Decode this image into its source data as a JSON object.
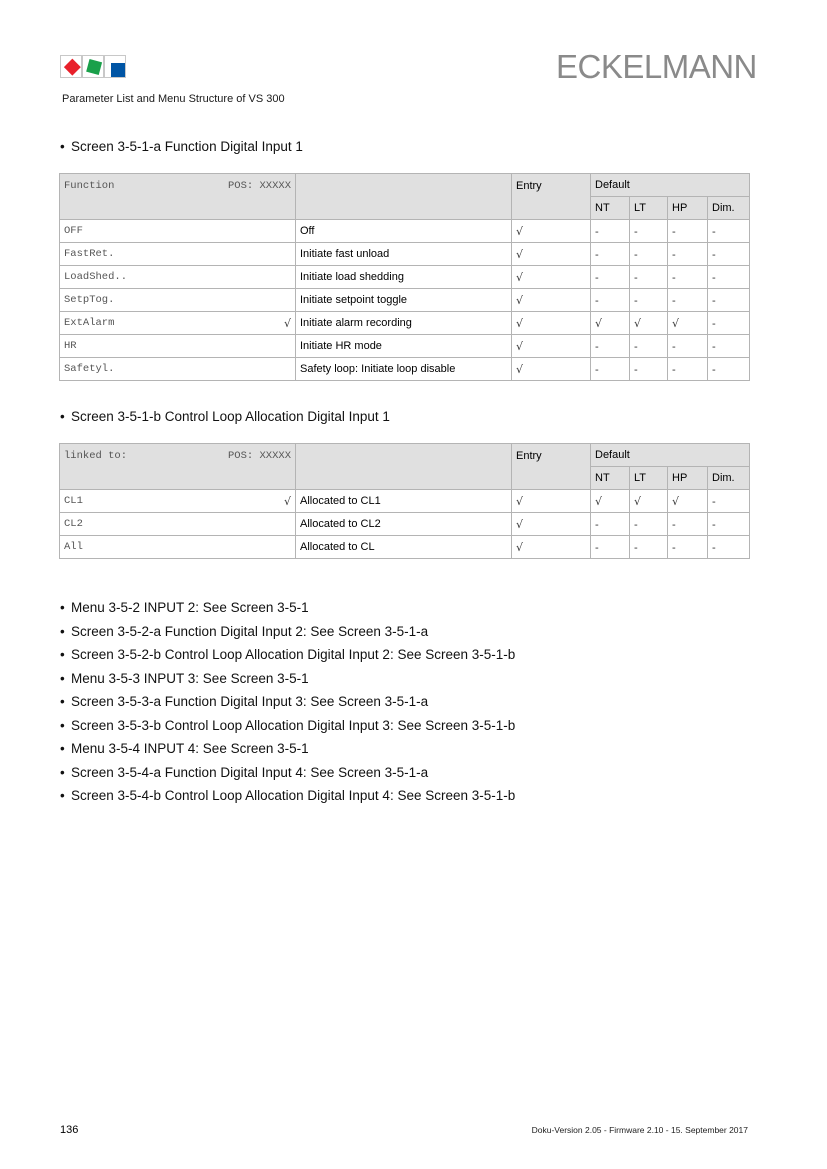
{
  "header": {
    "brand": "ECKELMANN",
    "subtitle": "Parameter List and Menu Structure of VS 300",
    "logo_colors": [
      "#e8202a",
      "#1aa04a",
      "#0055a5"
    ]
  },
  "bullet": "•",
  "check": "√",
  "sections": [
    {
      "heading": "Screen 3-5-1-a Function Digital Input 1",
      "table": {
        "header": {
          "param": "Function",
          "pos": "POS: XXXXX",
          "entry": "Entry",
          "default": "Default",
          "subcols": [
            "NT",
            "LT",
            "HP",
            "Dim."
          ]
        },
        "rows": [
          {
            "param": "OFF",
            "mark": "",
            "desc": "Off",
            "entry": "√",
            "nt": "-",
            "lt": "-",
            "hp": "-",
            "dim": "-"
          },
          {
            "param": "FastRet.",
            "mark": "",
            "desc": "Initiate fast unload",
            "entry": "√",
            "nt": "-",
            "lt": "-",
            "hp": "-",
            "dim": "-"
          },
          {
            "param": "LoadShed..",
            "mark": "",
            "desc": "Initiate load shedding",
            "entry": "√",
            "nt": "-",
            "lt": "-",
            "hp": "-",
            "dim": "-"
          },
          {
            "param": "SetpTog.",
            "mark": "",
            "desc": "Initiate setpoint toggle",
            "entry": "√",
            "nt": "-",
            "lt": "-",
            "hp": "-",
            "dim": "-"
          },
          {
            "param": "ExtAlarm",
            "mark": "√",
            "desc": "Initiate alarm recording",
            "entry": "√",
            "nt": "√",
            "lt": "√",
            "hp": "√",
            "dim": "-"
          },
          {
            "param": "HR",
            "mark": "",
            "desc": "Initiate HR mode",
            "entry": "√",
            "nt": "-",
            "lt": "-",
            "hp": "-",
            "dim": "-"
          },
          {
            "param": "Safetyl.",
            "mark": "",
            "desc": "Safety loop: Initiate loop disable",
            "entry": "√",
            "nt": "-",
            "lt": "-",
            "hp": "-",
            "dim": "-"
          }
        ]
      }
    },
    {
      "heading": "Screen 3-5-1-b Control Loop Allocation Digital Input 1",
      "table": {
        "header": {
          "param": "linked to:",
          "pos": "POS: XXXXX",
          "entry": "Entry",
          "default": "Default",
          "subcols": [
            "NT",
            "LT",
            "HP",
            "Dim."
          ]
        },
        "rows": [
          {
            "param": "CL1",
            "mark": "√",
            "desc": "Allocated to CL1",
            "entry": "√",
            "nt": "√",
            "lt": "√",
            "hp": "√",
            "dim": "-"
          },
          {
            "param": "CL2",
            "mark": "",
            "desc": "Allocated to CL2",
            "entry": "√",
            "nt": "-",
            "lt": "-",
            "hp": "-",
            "dim": "-"
          },
          {
            "param": "All",
            "mark": "",
            "desc": "Allocated to CL",
            "entry": "√",
            "nt": "-",
            "lt": "-",
            "hp": "-",
            "dim": "-"
          }
        ]
      }
    }
  ],
  "references": [
    "Menu 3-5-2 INPUT 2: See Screen 3-5-1",
    "Screen 3-5-2-a Function Digital Input 2: See Screen 3-5-1-a",
    "Screen 3-5-2-b Control Loop Allocation Digital Input 2: See Screen 3-5-1-b",
    "Menu 3-5-3 INPUT 3: See Screen 3-5-1",
    "Screen 3-5-3-a Function Digital Input 3: See Screen 3-5-1-a",
    "Screen 3-5-3-b Control Loop Allocation Digital Input 3: See Screen 3-5-1-b",
    "Menu 3-5-4 INPUT 4: See Screen 3-5-1",
    "Screen 3-5-4-a Function Digital Input 4: See Screen 3-5-1-a",
    "Screen 3-5-4-b Control Loop Allocation Digital Input 4: See Screen 3-5-1-b"
  ],
  "footer": {
    "page_number": "136",
    "version": "Doku-Version 2.05 - Firmware 2.10 - 15. September 2017"
  }
}
